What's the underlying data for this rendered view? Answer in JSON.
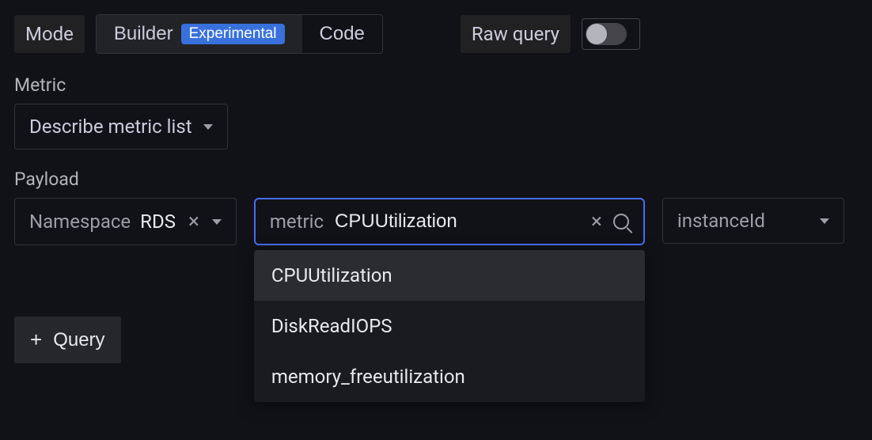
{
  "modeLabel": "Mode",
  "tabs": {
    "builder": "Builder",
    "builderBadge": "Experimental",
    "code": "Code"
  },
  "rawQueryLabel": "Raw query",
  "sections": {
    "metric": "Metric",
    "payload": "Payload"
  },
  "metricSelect": "Describe metric list",
  "payload": {
    "namespace": {
      "key": "Namespace",
      "val": "RDS"
    },
    "metric": {
      "key": "metric",
      "val": "CPUUtilization"
    },
    "instanceId": {
      "key": "instanceId"
    }
  },
  "dropdown": {
    "items": [
      "CPUUtilization",
      "DiskReadIOPS",
      "memory_freeutilization"
    ]
  },
  "addQuery": "Query"
}
